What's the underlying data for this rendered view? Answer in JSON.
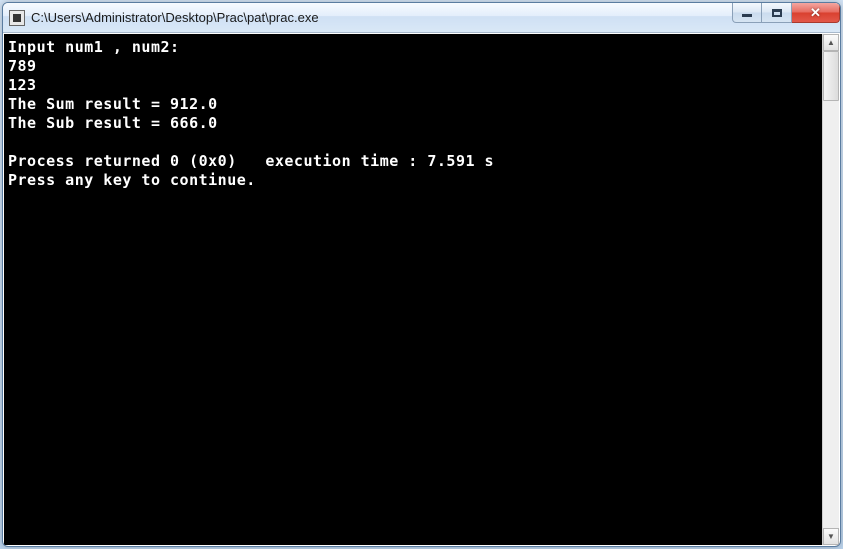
{
  "window": {
    "title": "C:\\Users\\Administrator\\Desktop\\Prac\\pat\\prac.exe"
  },
  "console": {
    "lines": [
      "Input num1 , num2:",
      "789",
      "123",
      "The Sum result = 912.0",
      "The Sub result = 666.0",
      "",
      "Process returned 0 (0x0)   execution time : 7.591 s",
      "Press any key to continue.",
      ""
    ]
  }
}
